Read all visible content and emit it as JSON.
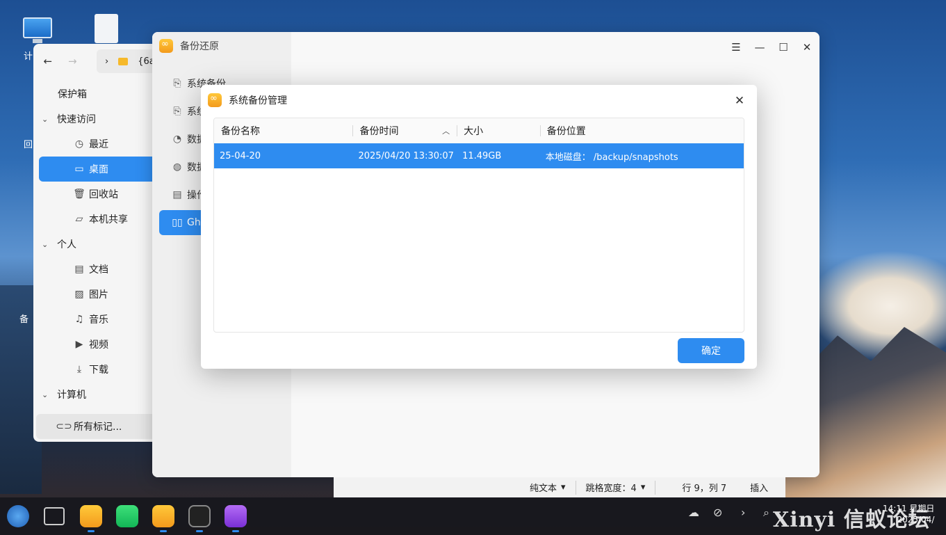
{
  "desktop": {
    "icons": [
      {
        "label": "计"
      },
      {
        "label": "回"
      },
      {
        "label": "备"
      }
    ]
  },
  "file_manager": {
    "path_text": "{6a",
    "top_item": "保护箱",
    "groups": [
      {
        "label": "快速访问",
        "items": [
          {
            "label": "最近",
            "icon": "clock-icon"
          },
          {
            "label": "桌面",
            "icon": "desktop-icon"
          },
          {
            "label": "回收站",
            "icon": "trash-icon"
          },
          {
            "label": "本机共享",
            "icon": "folder-icon"
          }
        ]
      },
      {
        "label": "个人",
        "items": [
          {
            "label": "文档",
            "icon": "document-icon"
          },
          {
            "label": "图片",
            "icon": "image-icon"
          },
          {
            "label": "音乐",
            "icon": "music-icon"
          },
          {
            "label": "视频",
            "icon": "video-icon"
          },
          {
            "label": "下载",
            "icon": "download-icon"
          }
        ]
      },
      {
        "label": "计算机"
      }
    ],
    "tags_label": "所有标记..."
  },
  "app": {
    "title": "备份还原",
    "nav": [
      {
        "label": "系统备份"
      },
      {
        "label": "系统"
      },
      {
        "label": "数据"
      },
      {
        "label": "数据"
      },
      {
        "label": "操作"
      },
      {
        "label": "Gho"
      }
    ]
  },
  "modal": {
    "title": "系统备份管理",
    "columns": [
      "备份名称",
      "备份时间",
      "大小",
      "备份位置"
    ],
    "rows": [
      {
        "name": "25-04-20",
        "time": "2025/04/20 13:30:07",
        "size": "11.49GB",
        "location": "本地磁盘： /backup/snapshots"
      }
    ],
    "ok_label": "确定"
  },
  "editor_status": {
    "mode": "纯文本",
    "tab_width": "跳格宽度：4",
    "position": "行 9，列 7",
    "insert": "插入"
  },
  "taskbar": {
    "clock_time": "14:11 星期日",
    "clock_date": "2025/04/"
  },
  "watermark": "Xinyi 信蚁论坛",
  "colors": {
    "accent": "#2e8cf0"
  }
}
